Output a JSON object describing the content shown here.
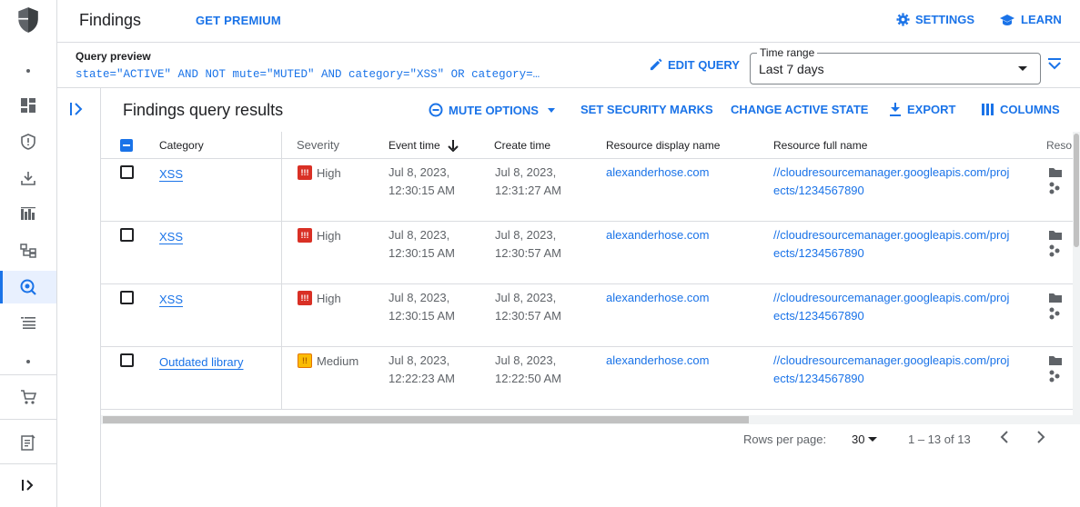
{
  "header": {
    "title": "Findings",
    "premium": "GET PREMIUM",
    "settings": "SETTINGS",
    "learn": "LEARN"
  },
  "query": {
    "label": "Query preview",
    "text": "state=\"ACTIVE\" AND NOT mute=\"MUTED\" AND category=\"XSS\" OR category=…",
    "edit": "EDIT QUERY",
    "time_label": "Time range",
    "time_value": "Last 7 days"
  },
  "results": {
    "title": "Findings query results",
    "mute": "MUTE OPTIONS",
    "marks": "SET SECURITY MARKS",
    "active": "CHANGE ACTIVE STATE",
    "export": "EXPORT",
    "columns": "COLUMNS"
  },
  "table": {
    "headers": [
      "Category",
      "Severity",
      "Event time",
      "Create time",
      "Resource display name",
      "Resource full name",
      "Reso"
    ],
    "rows": [
      {
        "category": "XSS",
        "severity": "High",
        "event1": "Jul 8, 2023,",
        "event2": "12:30:15 AM",
        "create1": "Jul 8, 2023,",
        "create2": "12:31:27 AM",
        "display": "alexanderhose.com",
        "full1": "//cloudresourcemanager.googleapis.com/proj",
        "full2": "ects/1234567890"
      },
      {
        "category": "XSS",
        "severity": "High",
        "event1": "Jul 8, 2023,",
        "event2": "12:30:15 AM",
        "create1": "Jul 8, 2023,",
        "create2": "12:30:57 AM",
        "display": "alexanderhose.com",
        "full1": "//cloudresourcemanager.googleapis.com/proj",
        "full2": "ects/1234567890"
      },
      {
        "category": "XSS",
        "severity": "High",
        "event1": "Jul 8, 2023,",
        "event2": "12:30:15 AM",
        "create1": "Jul 8, 2023,",
        "create2": "12:30:57 AM",
        "display": "alexanderhose.com",
        "full1": "//cloudresourcemanager.googleapis.com/proj",
        "full2": "ects/1234567890"
      },
      {
        "category": "Outdated library",
        "severity": "Medium",
        "event1": "Jul 8, 2023,",
        "event2": "12:22:23 AM",
        "create1": "Jul 8, 2023,",
        "create2": "12:22:50 AM",
        "display": "alexanderhose.com",
        "full1": "//cloudresourcemanager.googleapis.com/proj",
        "full2": "ects/1234567890"
      }
    ]
  },
  "footer": {
    "rows_per_page_label": "Rows per page:",
    "rows_per_page": "30",
    "range": "1 – 13 of 13"
  },
  "colors": {
    "accent": "#1a73e8",
    "high": "#d93025",
    "medium": "#fbbc04"
  }
}
